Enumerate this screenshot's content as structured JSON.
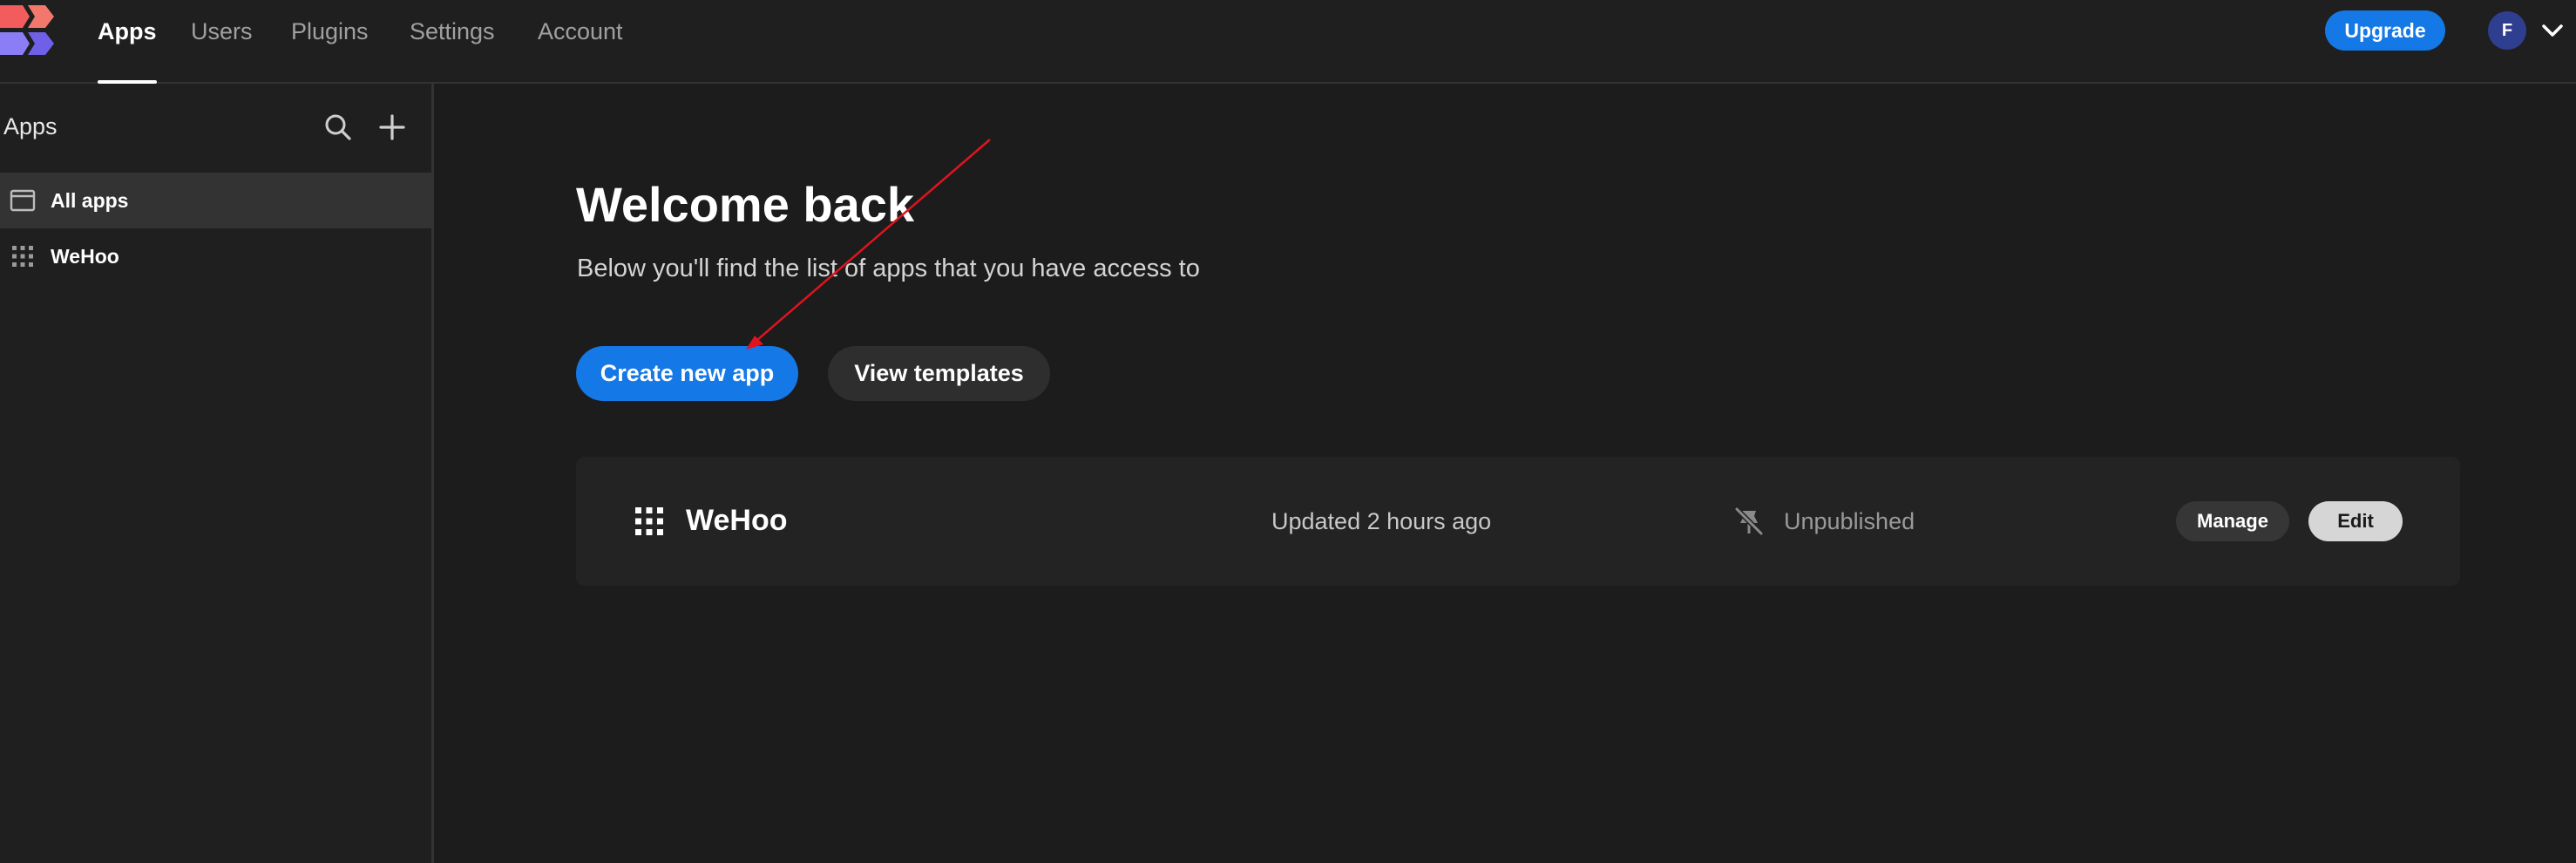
{
  "nav": {
    "tabs": [
      {
        "label": "Apps",
        "active": true
      },
      {
        "label": "Users",
        "active": false
      },
      {
        "label": "Plugins",
        "active": false
      },
      {
        "label": "Settings",
        "active": false
      },
      {
        "label": "Account",
        "active": false
      }
    ],
    "upgrade_label": "Upgrade",
    "avatar_initial": "F"
  },
  "sidebar": {
    "title": "Apps",
    "items": [
      {
        "label": "All apps",
        "icon": "window-icon",
        "selected": true
      },
      {
        "label": "WeHoo",
        "icon": "grid-icon",
        "selected": false
      }
    ]
  },
  "main": {
    "title": "Welcome back",
    "subtitle": "Below you'll find the list of apps that you have access to",
    "create_label": "Create new app",
    "templates_label": "View templates",
    "apps": [
      {
        "name": "WeHoo",
        "updated": "Updated 2 hours ago",
        "status": "Unpublished",
        "manage_label": "Manage",
        "edit_label": "Edit"
      }
    ]
  },
  "colors": {
    "accent": "#1478e6",
    "background": "#1c1c1c",
    "annotation": "#e0141e"
  }
}
